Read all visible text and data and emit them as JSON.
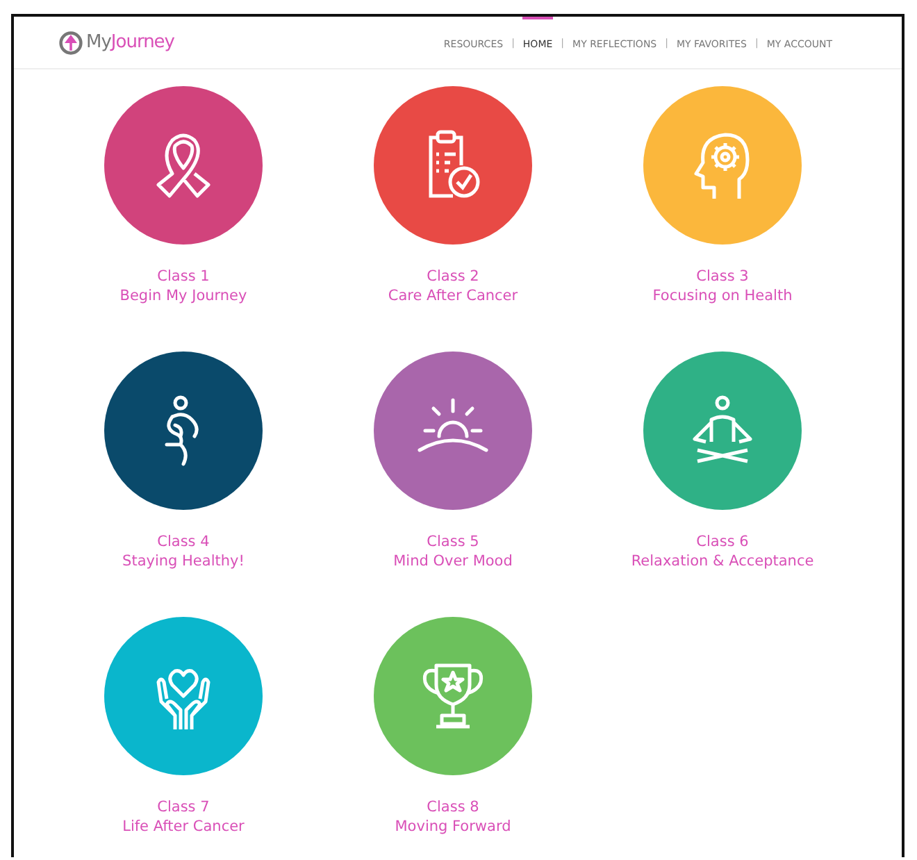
{
  "logo": {
    "first": "My",
    "second": "Journey"
  },
  "nav": [
    {
      "label": "RESOURCES",
      "selected": false
    },
    {
      "label": "HOME",
      "selected": true
    },
    {
      "label": "MY REFLECTIONS",
      "selected": false
    },
    {
      "label": "MY FAVORITES",
      "selected": false
    },
    {
      "label": "MY ACCOUNT",
      "selected": false
    }
  ],
  "separator": "|",
  "classes": [
    {
      "kind": "ribbon",
      "color": "#d1437c",
      "number": "Class 1",
      "title": "Begin My Journey"
    },
    {
      "kind": "clipboard",
      "color": "#e84a45",
      "number": "Class 2",
      "title": "Care After Cancer"
    },
    {
      "kind": "head-gear",
      "color": "#fbb73c",
      "number": "Class 3",
      "title": "Focusing on Health"
    },
    {
      "kind": "runner",
      "color": "#0a4a6b",
      "number": "Class 4",
      "title": "Staying Healthy!"
    },
    {
      "kind": "sunrise",
      "color": "#a966ab",
      "number": "Class 5",
      "title": "Mind Over Mood"
    },
    {
      "kind": "meditation",
      "color": "#2fb186",
      "number": "Class 6",
      "title": "Relaxation & Acceptance"
    },
    {
      "kind": "hands-heart",
      "color": "#0ab6cc",
      "number": "Class 7",
      "title": "Life After Cancer"
    },
    {
      "kind": "trophy",
      "color": "#6cc15c",
      "number": "Class 8",
      "title": "Moving Forward"
    }
  ]
}
